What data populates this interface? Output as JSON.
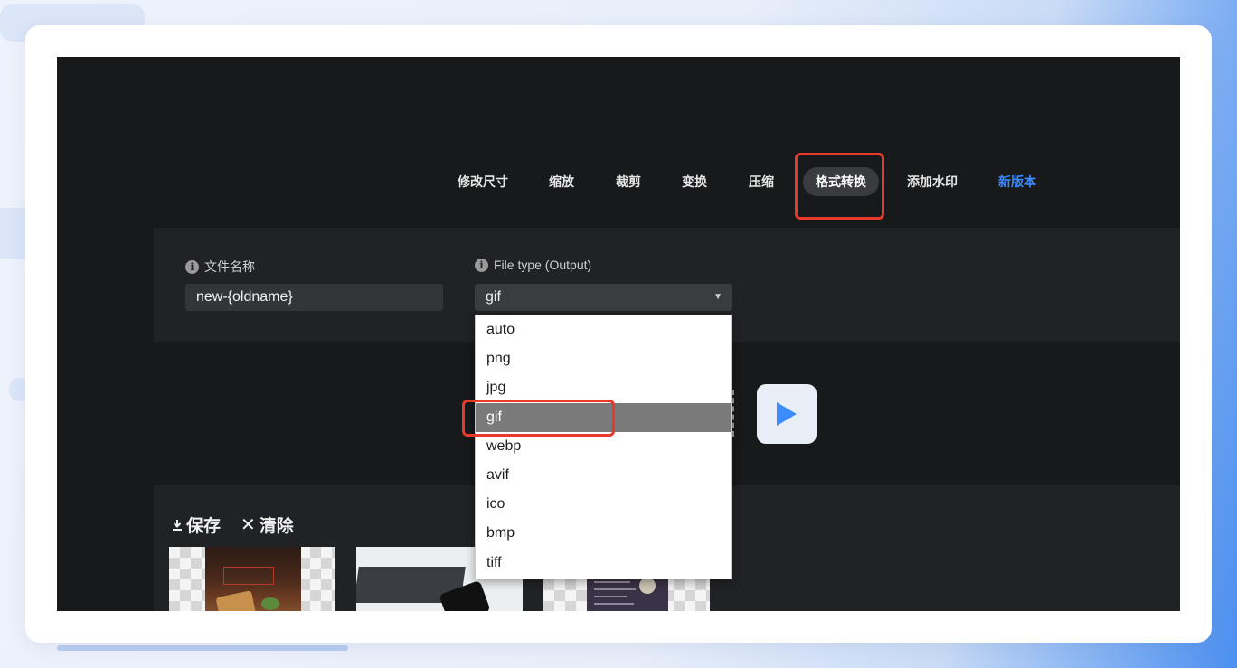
{
  "nav": {
    "items": [
      {
        "label": "修改尺寸"
      },
      {
        "label": "缩放"
      },
      {
        "label": "裁剪"
      },
      {
        "label": "变换"
      },
      {
        "label": "压缩"
      },
      {
        "label": "格式转换",
        "active": true
      },
      {
        "label": "添加水印"
      },
      {
        "label": "新版本",
        "color": "#3b8cff"
      }
    ]
  },
  "settings": {
    "filename_label": "文件名称",
    "filename_value": "new-{oldname}",
    "filetype_label": "File type (Output)",
    "filetype_selected": "gif"
  },
  "dropdown": {
    "options": [
      "auto",
      "png",
      "jpg",
      "gif",
      "webp",
      "avif",
      "ico",
      "bmp",
      "tiff"
    ],
    "highlighted": "gif"
  },
  "output": {
    "save_label": "保存",
    "clear_label": "清除"
  },
  "colors": {
    "app_bg": "#18191b",
    "panel_bg": "#212225",
    "accent": "#3b8cff",
    "annotation": "#e8392b",
    "play_icon": "#3b8cff"
  },
  "icons": {
    "info": "info-icon",
    "download": "download-icon",
    "close": "close-icon",
    "play": "play-icon",
    "dropdown_arrow": "chevron-down-icon"
  }
}
